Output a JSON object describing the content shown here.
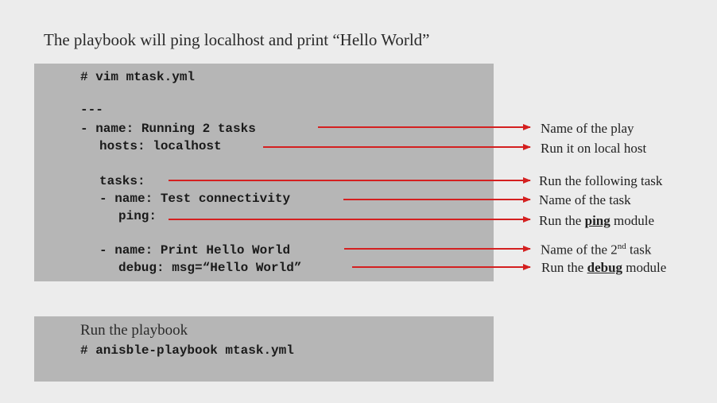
{
  "title": "The playbook will ping localhost and print “Hello World”",
  "code_block": {
    "line1": "# vim mtask.yml",
    "line2": "---",
    "line3": "- name: Running 2 tasks",
    "line4": "hosts: localhost",
    "line5": "tasks:",
    "line6": "- name: Test connectivity",
    "line7": "ping:",
    "line8": "- name: Print Hello World",
    "line9": "debug: msg=“Hello World”"
  },
  "annotations": {
    "play_name": "Name of the play",
    "local_host": "Run it on local host",
    "following_task": "Run the following task",
    "task_name": "Name of the task",
    "ping_prefix": "Run the ",
    "ping_word": "ping",
    "ping_suffix": " module",
    "task2_prefix": "Name of the 2",
    "task2_sup": "nd",
    "task2_suffix": " task",
    "debug_prefix": "Run the ",
    "debug_word": "debug",
    "debug_suffix": " module"
  },
  "run_block": {
    "label": "Run the playbook",
    "command": "# anisble-playbook mtask.yml"
  },
  "colors": {
    "background": "#ececec",
    "code_box": "#b6b6b6",
    "arrow": "#d42020"
  }
}
